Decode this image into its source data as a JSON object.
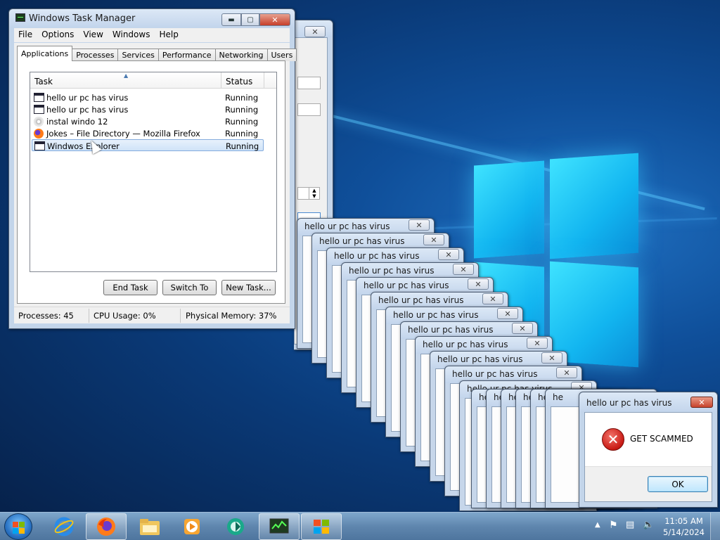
{
  "task_manager": {
    "title": "Windows Task Manager",
    "menu": [
      "File",
      "Options",
      "View",
      "Windows",
      "Help"
    ],
    "tabs": [
      "Applications",
      "Processes",
      "Services",
      "Performance",
      "Networking",
      "Users"
    ],
    "active_tab": "Applications",
    "columns": {
      "task": "Task",
      "status": "Status"
    },
    "tasks": [
      {
        "name": "hello ur pc has virus",
        "status": "Running",
        "icon": "window-icon"
      },
      {
        "name": "hello ur pc has virus",
        "status": "Running",
        "icon": "window-icon"
      },
      {
        "name": "instal windo 12",
        "status": "Running",
        "icon": "disc-icon"
      },
      {
        "name": "Jokes – File Directory — Mozilla Firefox",
        "status": "Running",
        "icon": "firefox-icon"
      },
      {
        "name": "Windwos Explorer",
        "status": "Running",
        "icon": "window-icon",
        "selected": true
      }
    ],
    "buttons": {
      "end_task": "End Task",
      "switch_to": "Switch To",
      "new_task": "New Task..."
    },
    "status_bar": {
      "processes": "Processes: 45",
      "cpu": "CPU Usage: 0%",
      "memory": "Physical Memory: 37%"
    }
  },
  "popup_stack": {
    "title": "hello ur pc has virus",
    "title_short": "he"
  },
  "scam_dialog": {
    "title": "hello ur pc has virus",
    "message": "GET SCAMMED",
    "ok": "OK"
  },
  "taskbar": {
    "items": [
      "start-orb",
      "internet-explorer-icon",
      "firefox-icon",
      "file-explorer-icon",
      "media-player-icon",
      "app-icon",
      "task-manager-icon",
      "windows-flag-icon"
    ],
    "clock_time": "11:05 AM",
    "clock_date": "5/14/2024"
  },
  "colors": {
    "accent": "#3fe3ff",
    "close_red": "#c7432c",
    "selection": "#cfe3f8"
  }
}
